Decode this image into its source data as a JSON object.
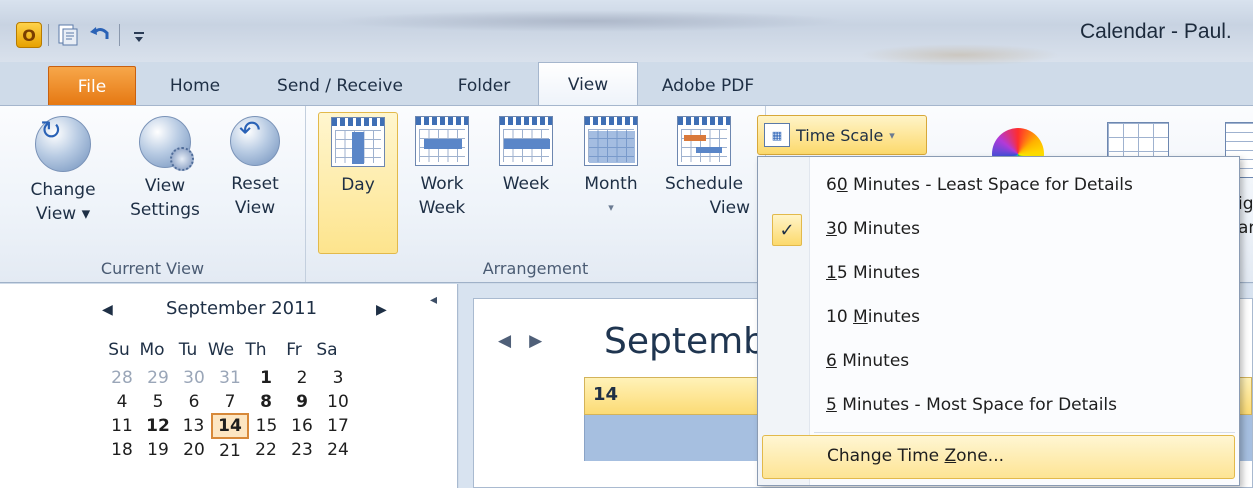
{
  "window": {
    "title": "Calendar - Paul.",
    "app_icon_letter": "O"
  },
  "tabs": [
    "File",
    "Home",
    "Send / Receive",
    "Folder",
    "View",
    "Adobe PDF"
  ],
  "active_tab": "View",
  "ribbon": {
    "current_view": {
      "group_label": "Current View",
      "buttons": [
        {
          "line1": "Change",
          "line2": "View ▾"
        },
        {
          "line1": "View",
          "line2": "Settings"
        },
        {
          "line1": "Reset",
          "line2": "View"
        }
      ]
    },
    "arrangement": {
      "group_label": "Arrangement",
      "buttons": [
        {
          "line1": "Day",
          "line2": ""
        },
        {
          "line1": "Work",
          "line2": "Week"
        },
        {
          "line1": "Week",
          "line2": ""
        },
        {
          "line1": "Month",
          "line2": "▾"
        },
        {
          "line1": "Schedule",
          "line2": "View"
        }
      ],
      "selected": "Day",
      "time_scale_label": "Time Scale",
      "time_scale_caret": "▾"
    },
    "partial_right_1": "ig",
    "partial_right_2": "ar"
  },
  "time_scale_menu": {
    "items": [
      {
        "pre": "6",
        "ul": "0",
        "post": " Minutes - Least Space for Details",
        "checked": false
      },
      {
        "pre": "",
        "ul": "3",
        "post": "0 Minutes",
        "checked": true
      },
      {
        "pre": "",
        "ul": "1",
        "post": "5 Minutes",
        "checked": false
      },
      {
        "pre": "10 ",
        "ul": "M",
        "post": "inutes",
        "checked": false
      },
      {
        "pre": "",
        "ul": "6",
        "post": " Minutes",
        "checked": false
      },
      {
        "pre": "",
        "ul": "5",
        "post": " Minutes - Most Space for Details",
        "checked": false
      }
    ],
    "change_time_zone": {
      "pre": "Change Time ",
      "ul": "Z",
      "post": "one..."
    },
    "check_mark": "✓"
  },
  "mini_calendar": {
    "month_title": "September 2011",
    "prev_arrow": "◀",
    "next_arrow": "▶",
    "collapse_arrow": "◂",
    "day_headers": [
      "Su",
      "Mo",
      "Tu",
      "We",
      "Th",
      "Fr",
      "Sa"
    ],
    "weeks": [
      [
        "28",
        "29",
        "30",
        "31",
        "1",
        "2",
        "3"
      ],
      [
        "4",
        "5",
        "6",
        "7",
        "8",
        "9",
        "10"
      ],
      [
        "11",
        "12",
        "13",
        "14",
        "15",
        "16",
        "17"
      ],
      [
        "18",
        "19",
        "20",
        "21",
        "22",
        "23",
        "24"
      ]
    ],
    "today": "14"
  },
  "main_calendar": {
    "title_partial": "Septemb",
    "nav_prev": "◀",
    "nav_next": "▶",
    "day_number": "14"
  }
}
